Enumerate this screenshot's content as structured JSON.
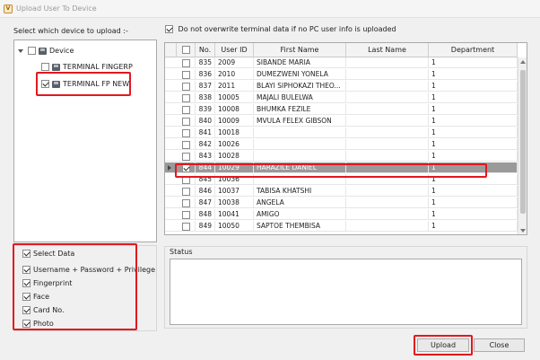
{
  "window": {
    "title": "Upload User To Device",
    "logo_text": "V"
  },
  "device_section": {
    "label": "Select which device to upload :-",
    "root": {
      "label": "Device",
      "checked": false
    },
    "devices": [
      {
        "label": "TERMINAL FINGERP",
        "checked": false
      },
      {
        "label": "TERMINAL FP NEW",
        "checked": true
      }
    ]
  },
  "overwrite_option": {
    "label": "Do not overwrite terminal data if no PC user info is uploaded",
    "checked": true
  },
  "grid": {
    "columns": [
      "No.",
      "User ID",
      "First Name",
      "Last Name",
      "Department"
    ],
    "rows": [
      {
        "no": "835",
        "user_id": "2009",
        "first_name": "SIBANDE MARIA",
        "last_name": "",
        "department": "1",
        "checked": false,
        "selected": false
      },
      {
        "no": "836",
        "user_id": "2010",
        "first_name": "DUMEZWENI YONELA",
        "last_name": "",
        "department": "1",
        "checked": false,
        "selected": false
      },
      {
        "no": "837",
        "user_id": "2011",
        "first_name": "BLAYI SIPHOKAZI THEO...",
        "last_name": "",
        "department": "1",
        "checked": false,
        "selected": false
      },
      {
        "no": "838",
        "user_id": "10005",
        "first_name": "MAJALI BULELWA",
        "last_name": "",
        "department": "1",
        "checked": false,
        "selected": false
      },
      {
        "no": "839",
        "user_id": "10008",
        "first_name": "BHUMKA FEZILE",
        "last_name": "",
        "department": "1",
        "checked": false,
        "selected": false
      },
      {
        "no": "840",
        "user_id": "10009",
        "first_name": "MVULA FELEX GIBSON",
        "last_name": "",
        "department": "1",
        "checked": false,
        "selected": false
      },
      {
        "no": "841",
        "user_id": "10018",
        "first_name": "",
        "last_name": "",
        "department": "1",
        "checked": false,
        "selected": false
      },
      {
        "no": "842",
        "user_id": "10026",
        "first_name": "",
        "last_name": "",
        "department": "1",
        "checked": false,
        "selected": false
      },
      {
        "no": "843",
        "user_id": "10028",
        "first_name": "",
        "last_name": "",
        "department": "1",
        "checked": false,
        "selected": false
      },
      {
        "no": "844",
        "user_id": "10029",
        "first_name": "HARAZILE DANIEL",
        "last_name": "",
        "department": "1",
        "checked": true,
        "selected": true
      },
      {
        "no": "845",
        "user_id": "10036",
        "first_name": "",
        "last_name": "",
        "department": "1",
        "checked": false,
        "selected": false
      },
      {
        "no": "846",
        "user_id": "10037",
        "first_name": "TABISA KHATSHI",
        "last_name": "",
        "department": "1",
        "checked": false,
        "selected": false
      },
      {
        "no": "847",
        "user_id": "10038",
        "first_name": "ANGELA",
        "last_name": "",
        "department": "1",
        "checked": false,
        "selected": false
      },
      {
        "no": "848",
        "user_id": "10041",
        "first_name": "AMIGO",
        "last_name": "",
        "department": "1",
        "checked": false,
        "selected": false
      },
      {
        "no": "849",
        "user_id": "10050",
        "first_name": "SAPTOE THEMBISA",
        "last_name": "",
        "department": "1",
        "checked": false,
        "selected": false
      }
    ]
  },
  "status": {
    "label": "Status"
  },
  "select_data": {
    "label": "Select Data",
    "checked": true,
    "options": [
      {
        "label": "Username + Password + Privilege",
        "checked": true
      },
      {
        "label": "Fingerprint",
        "checked": true
      },
      {
        "label": "Face",
        "checked": true
      },
      {
        "label": "Card No.",
        "checked": true
      },
      {
        "label": "Photo",
        "checked": true
      }
    ]
  },
  "buttons": {
    "upload": "Upload",
    "close": "Close"
  },
  "colors": {
    "highlight_border": "#e2181e",
    "selected_row": "#9a9a9a",
    "panel_bg": "#ffffff",
    "window_bg": "#f0f0f0"
  }
}
